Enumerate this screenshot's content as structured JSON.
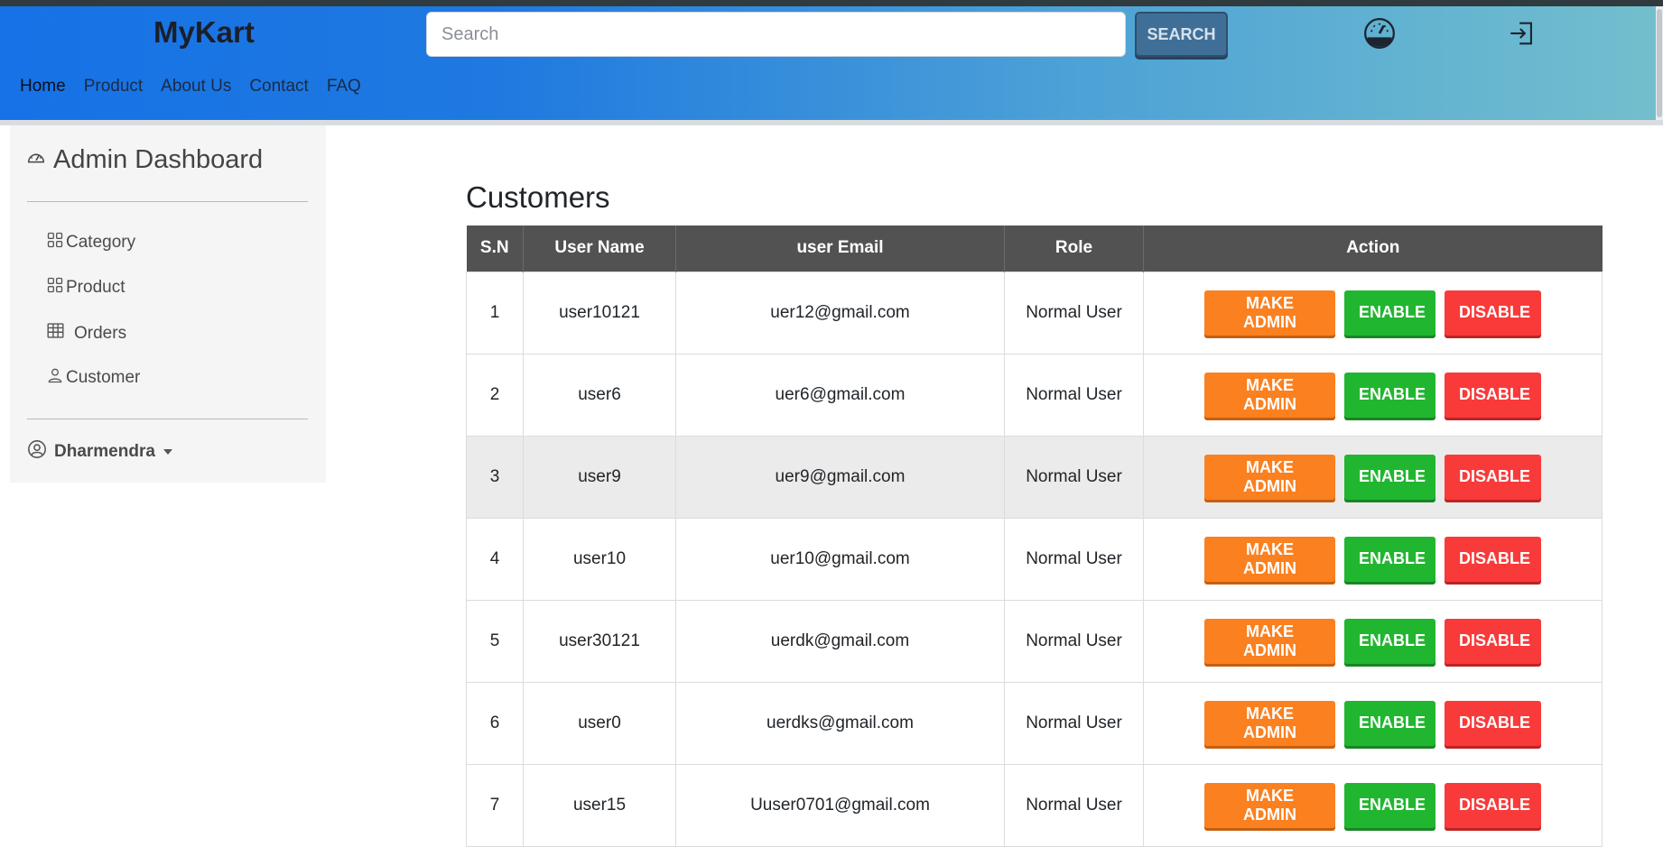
{
  "brand": "MyKart",
  "search": {
    "placeholder": "Search",
    "button_label": "SEARCH"
  },
  "nav": {
    "links": [
      "Home",
      "Product",
      "About Us",
      "Contact",
      "FAQ"
    ],
    "active": "Home"
  },
  "sidebar": {
    "title": "Admin Dashboard",
    "items": [
      {
        "label": "Category",
        "icon": "grid-icon"
      },
      {
        "label": "Product",
        "icon": "grid-icon"
      },
      {
        "label": "Orders",
        "icon": "table-icon"
      },
      {
        "label": "Customer",
        "icon": "person-icon"
      }
    ],
    "user": "Dharmendra"
  },
  "main": {
    "title": "Customers",
    "columns": [
      "S.N",
      "User Name",
      "user Email",
      "Role",
      "Action"
    ],
    "action_labels": {
      "make_admin": "MAKE ADMIN",
      "enable": "ENABLE",
      "disable": "DISABLE"
    },
    "rows": [
      {
        "sn": "1",
        "name": "user10121",
        "email": "uer12@gmail.com",
        "role": "Normal User"
      },
      {
        "sn": "2",
        "name": "user6",
        "email": "uer6@gmail.com",
        "role": "Normal User"
      },
      {
        "sn": "3",
        "name": "user9",
        "email": "uer9@gmail.com",
        "role": "Normal User"
      },
      {
        "sn": "4",
        "name": "user10",
        "email": "uer10@gmail.com",
        "role": "Normal User"
      },
      {
        "sn": "5",
        "name": "user30121",
        "email": "uerdk@gmail.com",
        "role": "Normal User"
      },
      {
        "sn": "6",
        "name": "user0",
        "email": "uerdks@gmail.com",
        "role": "Normal User"
      },
      {
        "sn": "7",
        "name": "user15",
        "email": "Uuser0701@gmail.com",
        "role": "Normal User"
      }
    ]
  },
  "colors": {
    "make_admin": "#fb801f",
    "enable": "#21b62f",
    "disable": "#f93a3a",
    "header": "#525252"
  }
}
